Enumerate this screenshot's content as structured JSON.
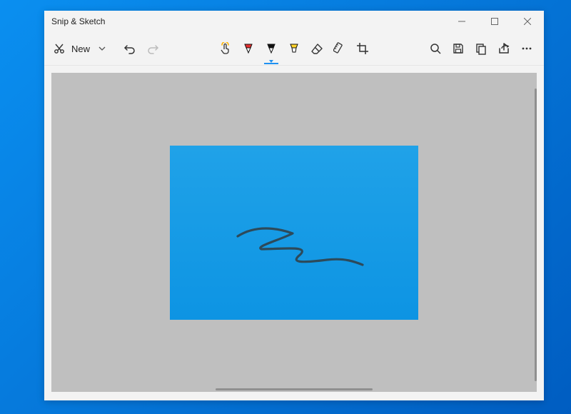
{
  "window": {
    "title": "Snip & Sketch"
  },
  "toolbar": {
    "new_label": "New"
  },
  "icons": {
    "snip": "snip-icon",
    "chevron_down": "chevron-down-icon",
    "undo": "undo-icon",
    "redo": "redo-icon",
    "touch": "touch-icon",
    "ballpoint": "ballpoint-pen-icon",
    "pencil": "pencil-icon",
    "highlighter": "highlighter-icon",
    "eraser": "eraser-icon",
    "ruler": "ruler-icon",
    "crop": "crop-icon",
    "zoom": "zoom-icon",
    "save": "save-icon",
    "copy": "copy-icon",
    "share": "share-icon",
    "more": "more-icon",
    "minimize": "minimize-icon",
    "maximize": "maximize-icon",
    "close": "close-icon"
  },
  "colors": {
    "accent": "#1f91f1",
    "ballpoint": "#e22d2d",
    "pencil": "#111111",
    "highlighter": "#ffd42a",
    "canvas_bg": "#bfbfbf",
    "snip_top": "#20a2e8",
    "snip_bottom": "#0d94e3",
    "scribble": "#2d4a5a"
  },
  "state": {
    "selected_tool": "pencil"
  }
}
